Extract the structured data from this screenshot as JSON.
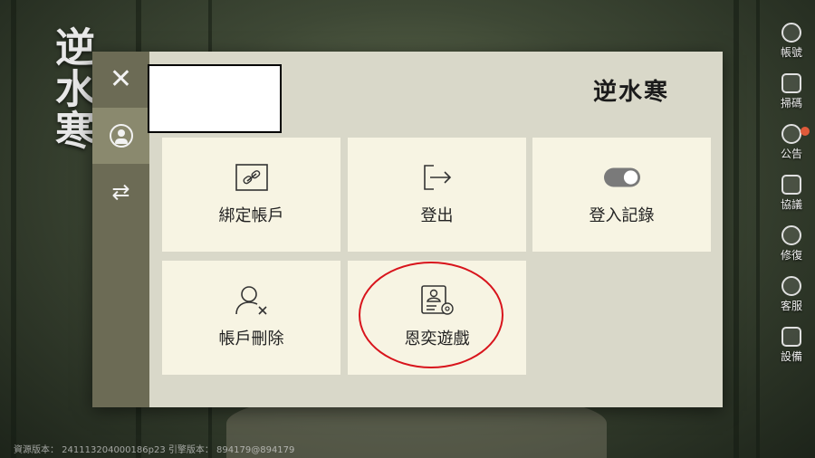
{
  "game_logo": "逆水寒",
  "side_menu": [
    {
      "label": "帳號",
      "icon": "account-icon"
    },
    {
      "label": "掃碼",
      "icon": "scan-icon"
    },
    {
      "label": "公告",
      "icon": "announcement-icon"
    },
    {
      "label": "協議",
      "icon": "agreement-icon"
    },
    {
      "label": "修復",
      "icon": "repair-icon"
    },
    {
      "label": "客服",
      "icon": "support-icon"
    },
    {
      "label": "設備",
      "icon": "device-icon"
    }
  ],
  "footer": {
    "version_text": "資源版本： 241113204000186p23  引擎版本： 894179@894179"
  },
  "panel": {
    "logo": "逆水寒",
    "tiles": [
      {
        "label": "綁定帳戶",
        "icon": "link-icon"
      },
      {
        "label": "登出",
        "icon": "logout-icon"
      },
      {
        "label": "登入記錄",
        "icon": "toggle-icon"
      },
      {
        "label": "帳戶刪除",
        "icon": "delete-user-icon"
      },
      {
        "label": "恩奕遊戲",
        "icon": "profile-settings-icon"
      }
    ]
  },
  "colors": {
    "panel_bg": "#d9d8c9",
    "rail_bg": "#6c6b55",
    "tile_bg": "#f7f4e3",
    "highlight": "#d8141c"
  }
}
